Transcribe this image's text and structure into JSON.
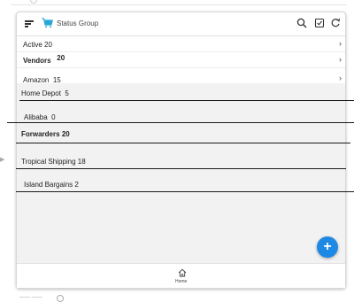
{
  "header": {
    "title": "Status Group",
    "icons": [
      "menu-icon",
      "cart-icon",
      "search-icon",
      "checkbox-icon",
      "refresh-icon"
    ]
  },
  "rows": [
    {
      "label": "Active",
      "count": "20",
      "bold": false
    },
    {
      "label": "Vendors",
      "count": "20",
      "bold": true
    },
    {
      "label": "Amazon",
      "count": "15",
      "bold": false
    }
  ],
  "group_items": [
    {
      "label": "Home Depot",
      "count": "5",
      "bold": false
    },
    {
      "label": "Alibaba",
      "count": "0",
      "bold": false
    },
    {
      "label": "Forwarders",
      "count": "20",
      "bold": true
    },
    {
      "label": "Tropical Shipping",
      "count": "18",
      "bold": false
    },
    {
      "label": "Island Bargains",
      "count": "2",
      "bold": false
    }
  ],
  "fab": {
    "label": "+"
  },
  "bottom_nav": {
    "home_label": "Home"
  },
  "colors": {
    "accent": "#1e88e5",
    "cart": "#29a8d8"
  }
}
